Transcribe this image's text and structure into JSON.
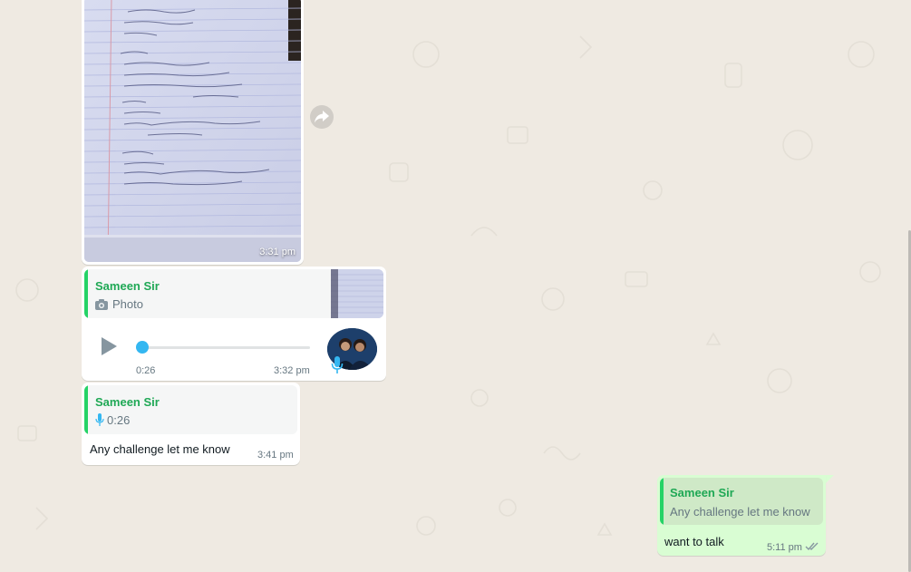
{
  "messages": {
    "image_message": {
      "time": "3:31 pm"
    },
    "voice_reply": {
      "quote": {
        "sender": "Sameen Sir",
        "text": "Photo"
      },
      "voice": {
        "duration": "0:26",
        "time": "3:32 pm"
      }
    },
    "text_reply": {
      "quote": {
        "sender": "Sameen Sir",
        "duration": "0:26"
      },
      "text": "Any challenge let me know",
      "time": "3:41 pm"
    },
    "outgoing": {
      "quote": {
        "sender": "Sameen Sir",
        "text": "Any challenge let me know"
      },
      "text": "want to talk",
      "time": "5:11 pm",
      "status": "read"
    }
  },
  "colors": {
    "chat_background": "#efeae2",
    "incoming_bubble": "#ffffff",
    "outgoing_bubble": "#d9fdd3",
    "quote_accent": "#25d366",
    "voice_accent": "#34b7f1"
  },
  "icons": [
    "forward-icon",
    "camera-icon",
    "play-icon",
    "mic-icon",
    "double-check-icon"
  ]
}
